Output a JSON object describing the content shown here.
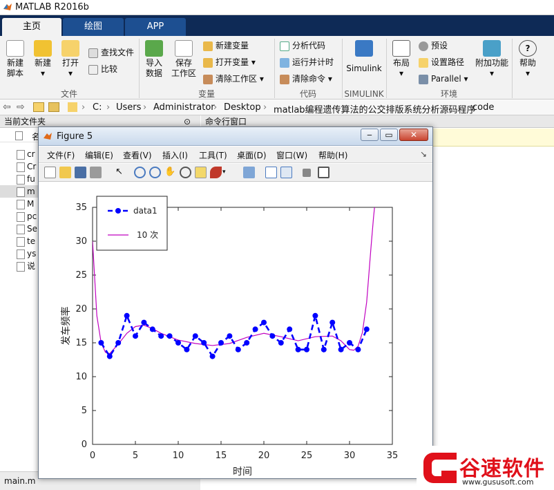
{
  "app": {
    "title": "MATLAB R2016b"
  },
  "tabs": [
    "主页",
    "绘图",
    "APP"
  ],
  "ribbon": {
    "large": {
      "new_script": "新建\n脚本",
      "new": "新建",
      "open": "打开",
      "import": "导入\n数据",
      "save_ws": "保存\n工作区",
      "simulink": "Simulink",
      "layout": "布局",
      "addons": "附加功能",
      "help": "帮助"
    },
    "small": {
      "find_files": "查找文件",
      "compare": "比较",
      "new_var": "新建变量",
      "open_var": "打开变量",
      "clear_ws": "清除工作区",
      "analyze": "分析代码",
      "run_time": "运行并计时",
      "clear_cmd": "清除命令",
      "prefs": "预设",
      "set_path": "设置路径",
      "parallel": "Parallel"
    },
    "sections": {
      "file": "文件",
      "variable": "变量",
      "code": "代码",
      "simulink": "SIMULINK",
      "env": "环境"
    }
  },
  "address": {
    "crumbs": [
      "C:",
      "Users",
      "Administrator",
      "Desktop",
      "matlab编程遗传算法的公交排版系统分析源码程序",
      "code"
    ]
  },
  "left_panel": {
    "title": "当前文件夹",
    "name_col": "名",
    "files": [
      "cr",
      "Cr",
      "fu",
      "m",
      "M",
      "pc",
      "Se",
      "te",
      "ys",
      "说"
    ],
    "bottom_file": "main.m"
  },
  "command": {
    "title": "命令行窗口"
  },
  "figure": {
    "title": "Figure 5",
    "window_buttons": [
      "‒",
      "▭",
      "✕"
    ],
    "menu": [
      "文件(F)",
      "编辑(E)",
      "查看(V)",
      "插入(I)",
      "工具(T)",
      "桌面(D)",
      "窗口(W)",
      "帮助(H)"
    ]
  },
  "chart_data": {
    "type": "line",
    "xlabel": "时间",
    "ylabel": "发车频率",
    "xlim": [
      0,
      35
    ],
    "ylim": [
      0,
      35
    ],
    "xticks": [
      0,
      5,
      10,
      15,
      20,
      25,
      30,
      35
    ],
    "yticks": [
      0,
      5,
      10,
      15,
      20,
      25,
      30,
      35
    ],
    "legend_position": "top-left",
    "series": [
      {
        "name": "data1",
        "color": "#0000ff",
        "style": "dashed-markers",
        "x": [
          1,
          2,
          3,
          4,
          5,
          6,
          7,
          8,
          9,
          10,
          11,
          12,
          13,
          14,
          15,
          16,
          17,
          18,
          19,
          20,
          21,
          22,
          23,
          24,
          25,
          26,
          27,
          28,
          29,
          30,
          31,
          32
        ],
        "values": [
          15,
          13,
          15,
          19,
          16,
          18,
          17,
          16,
          16,
          15,
          14,
          16,
          15,
          13,
          15,
          16,
          14,
          15,
          17,
          18,
          16,
          15,
          17,
          14,
          14,
          19,
          14,
          18,
          14,
          15,
          14,
          17
        ]
      },
      {
        "name": "10 次",
        "color": "#c000c0",
        "style": "solid",
        "x": [
          0,
          0.5,
          1,
          1.5,
          2,
          3,
          4,
          5,
          6,
          7,
          8,
          10,
          12,
          14,
          16,
          18,
          20,
          22,
          24,
          26,
          28,
          29,
          30,
          30.5,
          31,
          31.5,
          32,
          32.5,
          32.8,
          33
        ],
        "values": [
          30,
          19,
          15,
          13.6,
          13.4,
          14.8,
          16.4,
          17.4,
          17.6,
          17.1,
          16.4,
          15.4,
          14.9,
          14.6,
          14.9,
          15.8,
          16.4,
          15.9,
          15.3,
          15.9,
          16.0,
          15.3,
          14.0,
          13.9,
          14.5,
          16.5,
          21,
          29,
          33.5,
          36
        ]
      }
    ]
  },
  "watermark": {
    "text": "谷速软件",
    "url": "www.gususoft.com",
    "color": "#e0101a"
  }
}
